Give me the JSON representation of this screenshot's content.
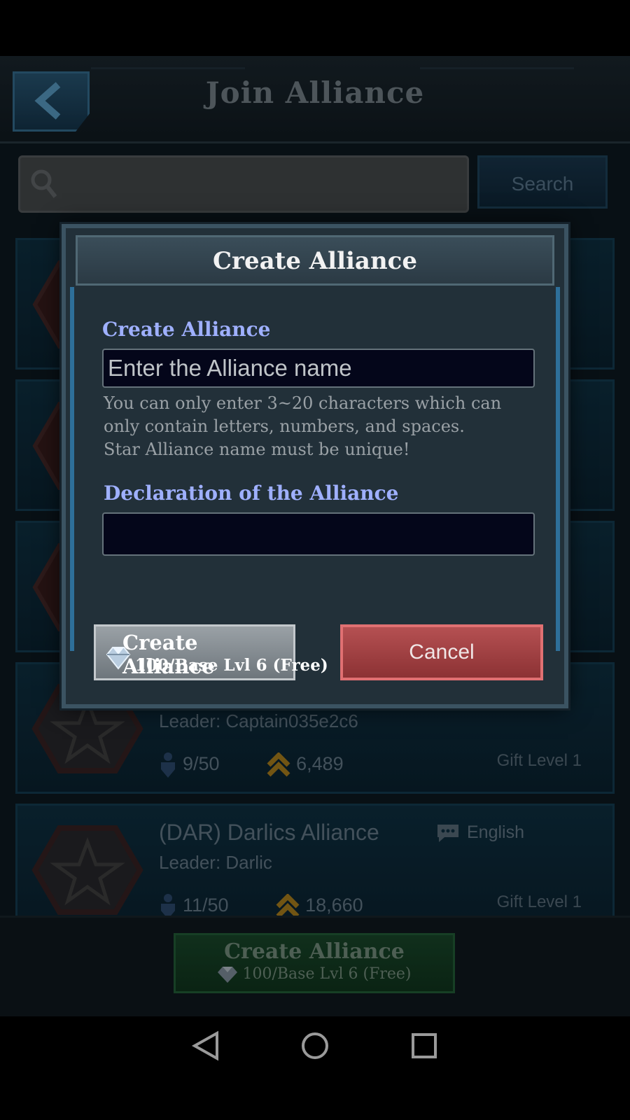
{
  "header": {
    "title": "Join Alliance",
    "back_icon": "chevron-left-icon"
  },
  "search": {
    "placeholder": "",
    "button_label": "Search"
  },
  "alliances": [
    {
      "name": "",
      "leader": "Leader: Captain035e2c6",
      "language": "",
      "members": "9/50",
      "power": "6,489",
      "gift": "Gift Level 1"
    },
    {
      "name": "(DAR) Darlics Alliance",
      "leader": "Leader: Darlic",
      "language": "English",
      "members": "11/50",
      "power": "18,660",
      "gift": "Gift Level 1"
    }
  ],
  "bottom_create": {
    "title": "Create Alliance",
    "cost": "100/Base Lvl 6 (Free)"
  },
  "modal": {
    "title": "Create Alliance",
    "name_label": "Create Alliance",
    "name_placeholder": "Enter the Alliance name",
    "hint": "You can only enter 3~20 characters which can\nonly contain letters, numbers, and spaces.\n Star Alliance name must be unique!",
    "declaration_label": "Declaration of the Alliance",
    "declaration_value": "",
    "create_button": {
      "title": "Create Alliance",
      "cost": "100/Base Lvl 6 (Free)"
    },
    "cancel_label": "Cancel"
  },
  "colors": {
    "label": "#9fb0ff",
    "cancel": "#b55052",
    "create": "#8a9196"
  }
}
